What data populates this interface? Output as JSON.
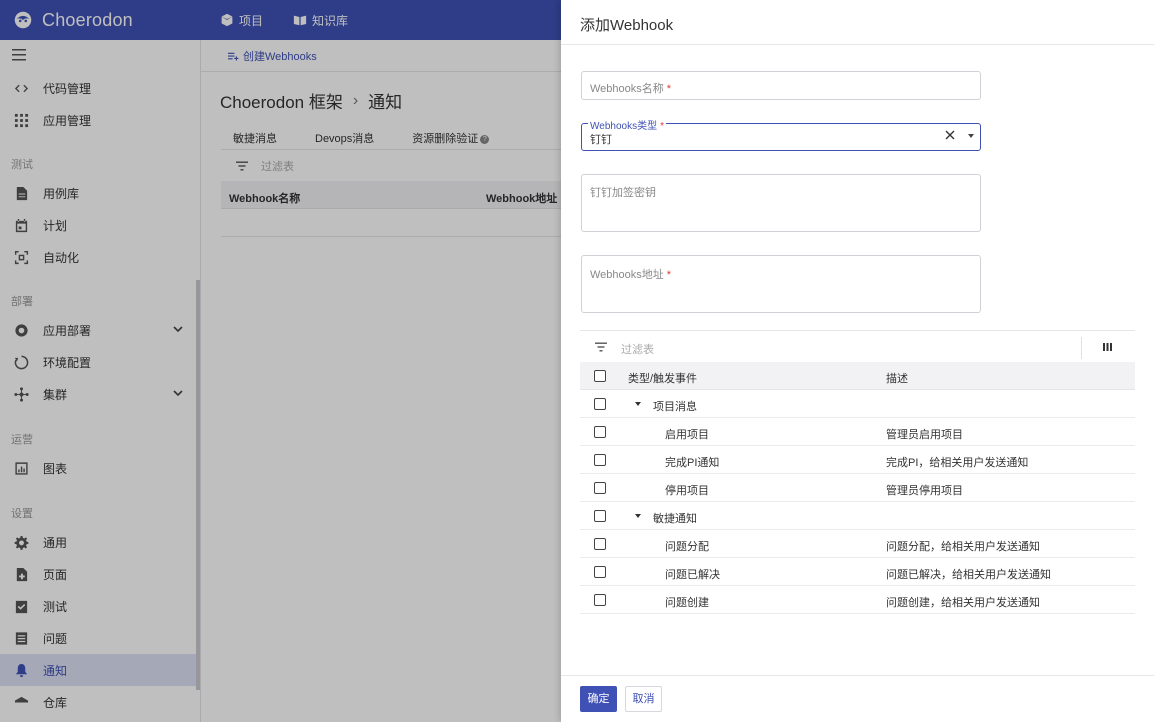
{
  "header": {
    "brand": "Choerodon",
    "nav": [
      {
        "label": "项目",
        "icon": "cube-icon"
      },
      {
        "label": "知识库",
        "icon": "book-icon"
      }
    ]
  },
  "sidebar": {
    "items": [
      {
        "label": "代码管理",
        "icon": "code-icon"
      },
      {
        "label": "应用管理",
        "icon": "grid-icon"
      },
      {
        "group": "测试"
      },
      {
        "label": "用例库",
        "icon": "file-icon"
      },
      {
        "label": "计划",
        "icon": "calendar-icon"
      },
      {
        "label": "自动化",
        "icon": "robot-icon"
      },
      {
        "group": "部署"
      },
      {
        "label": "应用部署",
        "icon": "deploy-icon"
      },
      {
        "label": "环境配置",
        "icon": "environment-icon"
      },
      {
        "label": "集群",
        "icon": "cluster-icon"
      },
      {
        "group": "运营"
      },
      {
        "label": "图表",
        "icon": "chart-icon"
      },
      {
        "group": "设置"
      },
      {
        "label": "通用",
        "icon": "gear-icon"
      },
      {
        "label": "页面",
        "icon": "page-icon"
      },
      {
        "label": "测试",
        "icon": "check-icon"
      },
      {
        "label": "问题",
        "icon": "list-icon"
      },
      {
        "label": "通知",
        "icon": "bell-icon",
        "active": true
      },
      {
        "label": "仓库",
        "icon": "repo-icon"
      }
    ]
  },
  "main": {
    "action": "创建Webhooks",
    "breadcrumb": {
      "project": "Choerodon 框架",
      "page": "通知"
    },
    "tabs": [
      "敏捷消息",
      "Devops消息",
      "资源删除验证"
    ],
    "filter_placeholder": "过滤表",
    "columns": [
      "Webhook名称",
      "Webhook地址"
    ]
  },
  "drawer": {
    "title": "添加Webhook",
    "fields": {
      "name_placeholder": "Webhooks名称",
      "type_label": "Webhooks类型",
      "type_value": "钉钉",
      "secret_placeholder": "钉钉加签密钥",
      "url_placeholder": "Webhooks地址",
      "required_mark": "*"
    },
    "table": {
      "filter_placeholder": "过滤表",
      "columns": {
        "type": "类型/触发事件",
        "desc": "描述"
      },
      "rows": [
        {
          "type": "项目消息",
          "desc": "",
          "group": true
        },
        {
          "type": "启用项目",
          "desc": "管理员启用项目"
        },
        {
          "type": "完成PI通知",
          "desc": "完成PI，给相关用户发送通知"
        },
        {
          "type": "停用项目",
          "desc": "管理员停用项目"
        },
        {
          "type": "敏捷通知",
          "desc": "",
          "group": true
        },
        {
          "type": "问题分配",
          "desc": "问题分配，给相关用户发送通知"
        },
        {
          "type": "问题已解决",
          "desc": "问题已解决，给相关用户发送通知"
        },
        {
          "type": "问题创建",
          "desc": "问题创建，给相关用户发送通知"
        }
      ]
    },
    "footer": {
      "ok": "确定",
      "cancel": "取消"
    }
  },
  "colors": {
    "primary": "#3f51b5",
    "required": "#e53935"
  }
}
